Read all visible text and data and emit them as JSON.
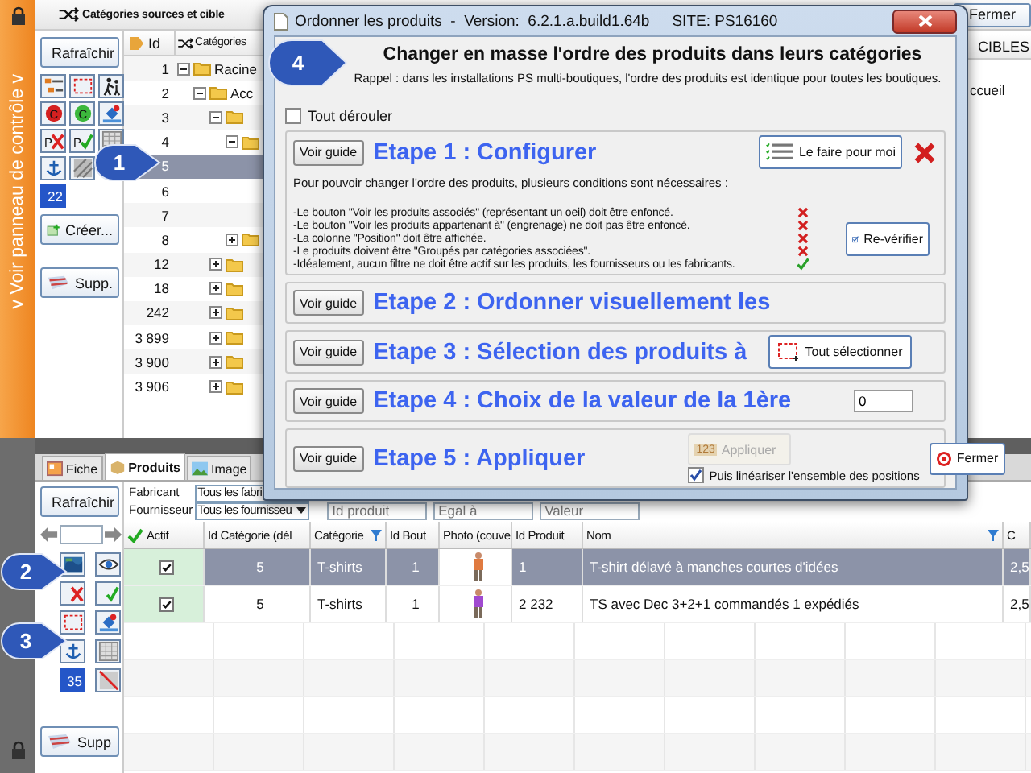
{
  "top_panel": {
    "side_label": "v  Voir panneau de contrôle  v",
    "title": "Catégories sources et cible",
    "close_button": "Fermer",
    "refresh_button": "Rafraîchir",
    "tools": [
      {
        "kind": "tree"
      },
      {
        "kind": "selection"
      },
      {
        "kind": "figures"
      },
      {
        "kind": "red-circle",
        "letter": "C"
      },
      {
        "kind": "green-circle",
        "letter": "C"
      },
      {
        "kind": "paint"
      },
      {
        "kind": "cross",
        "letter": "P"
      },
      {
        "kind": "check",
        "letter": "P"
      },
      {
        "kind": "table"
      },
      {
        "kind": "anchor"
      },
      {
        "kind": "stripes"
      },
      {
        "kind": "empty"
      },
      {
        "kind": "count",
        "text": "22"
      }
    ],
    "create_button": "Créer...",
    "delete_button": "Supp.",
    "tree": {
      "columns": [
        "Id",
        "Catégories"
      ],
      "rows": [
        {
          "id": "1",
          "label": "Racine",
          "expanded": true,
          "selected": false,
          "children": [
            {
              "id": "2",
              "label": "Acc",
              "expanded": true,
              "selected": false,
              "children": [
                {
                  "id": "3",
                  "expanded": true,
                  "selected": false,
                  "children": [
                    {
                      "id": "4",
                      "expanded": true,
                      "selected": false,
                      "children": [
                        {
                          "id": "5",
                          "selected": true
                        },
                        {
                          "id": "6",
                          "selected": false
                        },
                        {
                          "id": "7",
                          "selected": false
                        }
                      ]
                    },
                    {
                      "id": "8",
                      "expanded": false,
                      "selected": false
                    }
                  ]
                },
                {
                  "id": "12",
                  "expanded": false,
                  "selected": false
                },
                {
                  "id": "18",
                  "expanded": false,
                  "selected": false
                },
                {
                  "id": "242",
                  "expanded": false,
                  "selected": false
                },
                {
                  "id": "3 899",
                  "expanded": false,
                  "selected": false
                },
                {
                  "id": "3 900",
                  "expanded": false,
                  "selected": false
                },
                {
                  "id": "3 906",
                  "expanded": false,
                  "selected": false
                }
              ]
            }
          ]
        }
      ]
    },
    "target_column": "CIBLES",
    "target_rows": [
      "ccueil"
    ]
  },
  "bottom_panel": {
    "tabs": [
      {
        "label": "Fiche",
        "kind": "card",
        "selected": false
      },
      {
        "label": "Produits",
        "kind": "box",
        "selected": true
      },
      {
        "label": "Image",
        "kind": "landscape",
        "selected": false
      }
    ],
    "refresh_button": "Rafraîchir",
    "manufacturer_label": "Fabricant",
    "manufacturer_value": "Tous les fabri",
    "supplier_label": "Fournisseur",
    "supplier_value": "Tous les fournisseu",
    "filter_fields": [
      {
        "placeholder": "Id produit"
      },
      {
        "placeholder": "Egal à"
      },
      {
        "placeholder": "Valeur"
      }
    ],
    "tools": [
      {
        "kind": "map"
      },
      {
        "kind": "eye"
      },
      {
        "kind": "cross"
      },
      {
        "kind": "check"
      },
      {
        "kind": "selection"
      },
      {
        "kind": "paint"
      },
      {
        "kind": "anchor"
      },
      {
        "kind": "table"
      },
      {
        "kind": "count",
        "text": "35"
      },
      {
        "kind": "nosign"
      }
    ],
    "delete_button": "Supp",
    "columns": [
      "Actif",
      "Id Catégorie (dél",
      "Catégorie",
      "Id Bout",
      "Photo (couve",
      "Id Produit",
      "Nom",
      "C"
    ],
    "rows": [
      {
        "active": true,
        "category_id": "5",
        "category": "T-shirts",
        "shop_id": "1",
        "product_id": "1",
        "name": "T-shirt délavé à manches courtes d'idées",
        "column_8": "2,5",
        "selected": true
      },
      {
        "active": true,
        "category_id": "5",
        "category": "T-shirts",
        "shop_id": "1",
        "product_id": "2 232",
        "name": "TS avec Dec 3+2+1 commandés 1 expédiés",
        "column_8": "2,5",
        "selected": false
      }
    ]
  },
  "dialog": {
    "title": "Ordonner les produits  -  Version:  6.2.1.a.build1.64b",
    "site": "SITE: PS16160",
    "heading": "Changer en masse l'ordre des produits dans leurs catégories",
    "reminder": "Rappel : dans les installations PS multi-boutiques, l'ordre des produits est identique pour toutes les boutiques.",
    "expand_all": {
      "label": "Tout dérouler",
      "checked": false
    },
    "steps": [
      {
        "kind": "configure",
        "guide_button": "Voir guide",
        "title": "Etape 1 : Configurer",
        "auto_button": "Le faire pour moi",
        "ok": false,
        "intro": "Pour pouvoir changer l'ordre des produits, plusieurs conditions sont nécessaires :",
        "conditions": [
          {
            "text": "-Le bouton \"Voir les produits associés\" (représentant un oeil) doit être enfoncé.",
            "met": false
          },
          {
            "text": "-Le bouton \"Voir les produits appartenant à\" (engrenage) ne doit pas être enfoncé.",
            "met": false
          },
          {
            "text": "-La colonne \"Position\" doit être affichée.",
            "met": false
          },
          {
            "text": "-Le produits doivent être \"Groupés par catégories associées\".",
            "met": false
          },
          {
            "text": "-Idéalement, aucun filtre ne doit être actif sur les produits, les fournisseurs ou les fabricants.",
            "met": true
          }
        ],
        "recheck_button": "Re-vérifier"
      },
      {
        "kind": "plain",
        "guide_button": "Voir guide",
        "title": "Etape 2 : Ordonner visuellement les"
      },
      {
        "kind": "select",
        "guide_button": "Voir guide",
        "title": "Etape 3 : Sélection des produits à",
        "select_button": "Tout sélectionner"
      },
      {
        "kind": "value",
        "guide_button": "Voir guide",
        "title": "Etape 4 : Choix de la valeur de la 1ère",
        "value": "0"
      },
      {
        "kind": "apply",
        "guide_button": "Voir guide",
        "title": "Etape 5 : Appliquer",
        "apply_button": {
          "label": "Appliquer",
          "icon_text": "123",
          "disabled": true
        },
        "close_button": "Fermer",
        "linearize": {
          "label": "Puis linéariser l'ensemble des positions",
          "checked": true
        }
      }
    ]
  },
  "callouts": [
    "1",
    "2",
    "3",
    "4"
  ]
}
